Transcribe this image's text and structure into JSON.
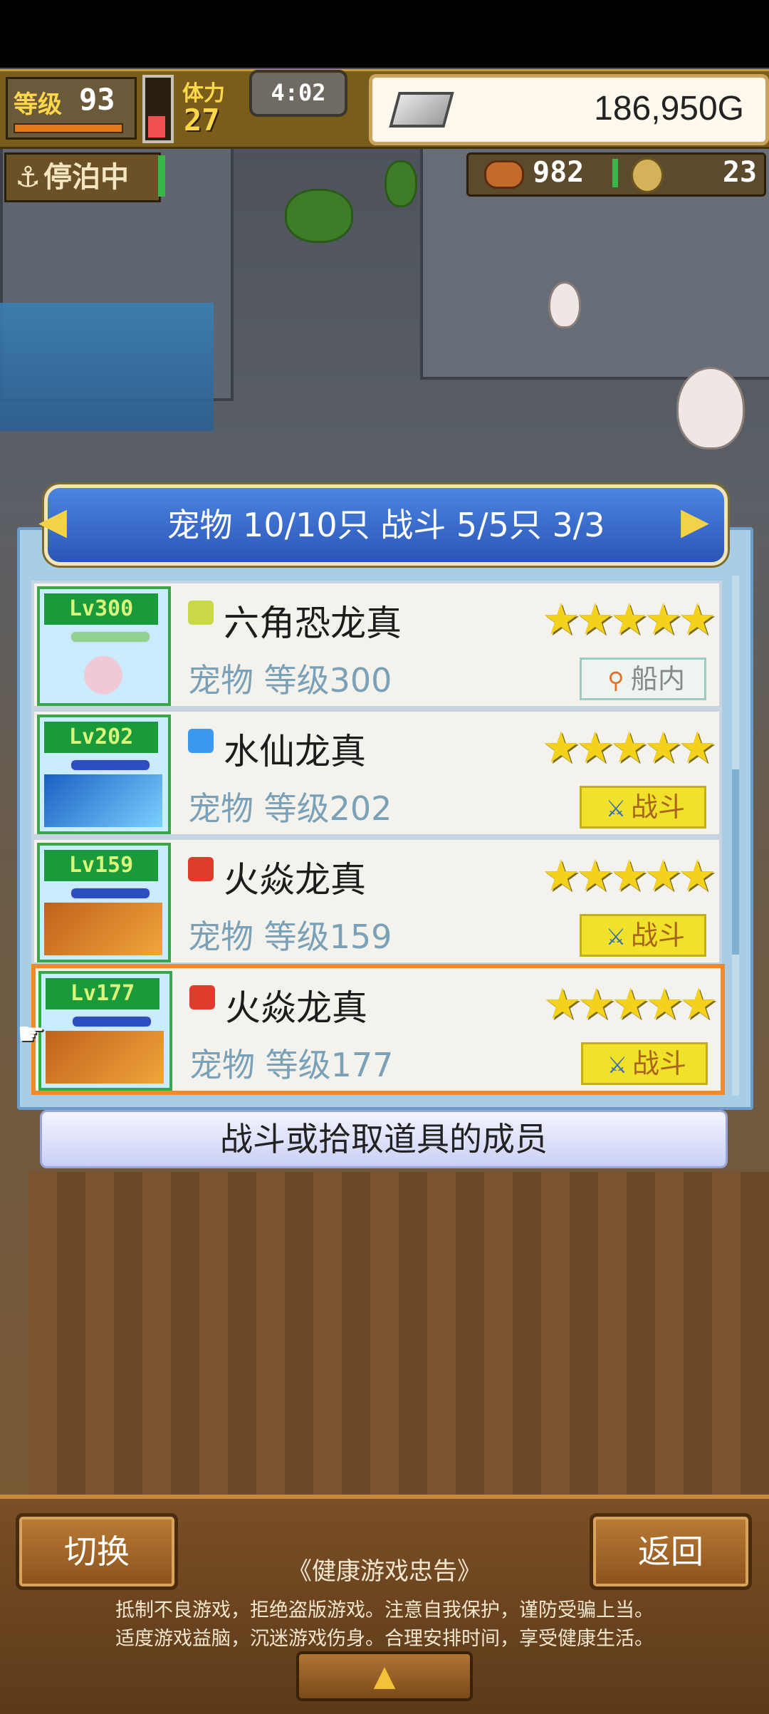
{
  "status": {
    "level_label": "等级",
    "level_value": "93",
    "stamina_label": "体力",
    "stamina_value": "27",
    "clock": "4:02",
    "money": "186,950G",
    "dock_status": "停泊中",
    "food": "982",
    "medals": "23"
  },
  "dialog": {
    "header": "宠物 10/10只 战斗 5/5只  3/3",
    "caption": "战斗或拾取道具的成员",
    "pets": [
      {
        "lv": "Lv300",
        "element": "electric",
        "name": "六角恐龙真",
        "stars": "★★★★★",
        "level_text": "宠物 等级300",
        "status": "船内",
        "status_type": "shipboard"
      },
      {
        "lv": "Lv202",
        "element": "water",
        "name": "水仙龙真",
        "stars": "★★★★★",
        "level_text": "宠物 等级202",
        "status": "战斗",
        "status_type": "battle"
      },
      {
        "lv": "Lv159",
        "element": "fire",
        "name": "火焱龙真",
        "stars": "★★★★★",
        "level_text": "宠物 等级159",
        "status": "战斗",
        "status_type": "battle"
      },
      {
        "lv": "Lv177",
        "element": "fire",
        "name": "火焱龙真",
        "stars": "★★★★★",
        "level_text": "宠物 等级177",
        "status": "战斗",
        "status_type": "battle"
      }
    ]
  },
  "bottom": {
    "switch_label": "切换",
    "back_label": "返回",
    "notice_title": "《健康游戏忠告》",
    "notice_line_1": "抵制不良游戏，拒绝盗版游戏。注意自我保护，谨防受骗上当。",
    "notice_line_2": "适度游戏益脑，沉迷游戏伤身。合理安排时间，享受健康生活。"
  },
  "colors": {
    "battle_badge": "#f0e22a",
    "selected_border": "#f08a2a",
    "header_blue": "#3a6fd0"
  }
}
